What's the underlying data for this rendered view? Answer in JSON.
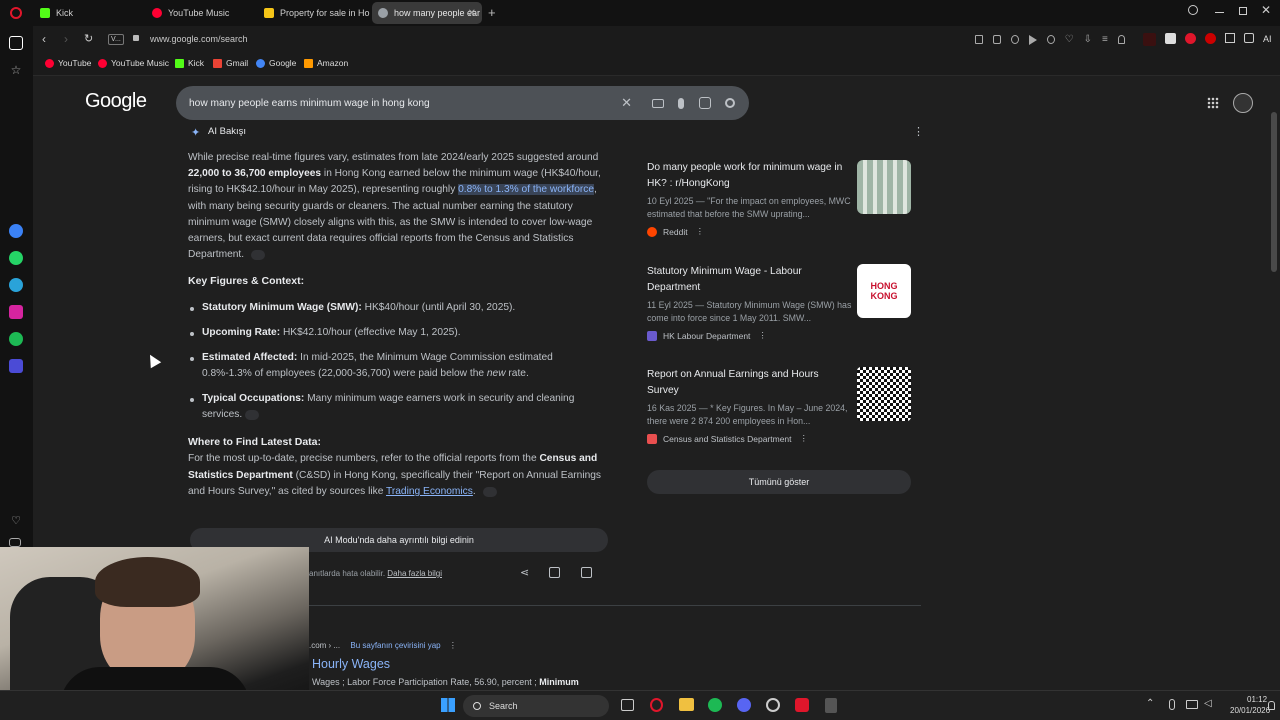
{
  "tabs": [
    {
      "label": "Kick",
      "color": "#53fc18"
    },
    {
      "label": "YouTube Music",
      "color": "#ff0033"
    },
    {
      "label": "Property for sale in Hong",
      "color": "#f5c518"
    },
    {
      "label": "how many people earns m",
      "color": "#9aa0a6"
    }
  ],
  "address": {
    "url": "www.google.com/search",
    "site_badge": "V..."
  },
  "bookmarks": [
    {
      "label": "YouTube",
      "color": "#ff0033"
    },
    {
      "label": "YouTube Music",
      "color": "#ff0033"
    },
    {
      "label": "Kick",
      "color": "#53fc18"
    },
    {
      "label": "Gmail",
      "color": "#ea4335"
    },
    {
      "label": "Google",
      "color": "#4285f4"
    },
    {
      "label": "Amazon",
      "color": "#ff9900"
    }
  ],
  "google": {
    "logo": "Google",
    "query": "how many people earns minimum wage in hong kong"
  },
  "ai": {
    "header": "AI Bakışı",
    "para_pre": "While precise real-time figures vary, estimates from late 2024/early 2025 suggested around ",
    "para_bold": "22,000 to 36,700 employees",
    "para_mid": " in Hong Kong earned below the minimum wage (HK$40/hour, rising to HK$42.10/hour in May 2025), representing roughly ",
    "para_hl": "0.8% to 1.3% of the workforce",
    "para_post": ", with many being security guards or cleaners. The actual number earning the statutory minimum wage (SMW) closely aligns with this, as the SMW is intended to cover low-wage earners, but exact current data requires official reports from the Census and Statistics Department.",
    "key_heading": "Key Figures & Context:",
    "bullets": [
      {
        "bold": "Statutory Minimum Wage (SMW):",
        "text": " HK$40/hour (until April 30, 2025)."
      },
      {
        "bold": "Upcoming Rate:",
        "text": " HK$42.10/hour (effective May 1, 2025)."
      },
      {
        "bold": "Estimated Affected:",
        "text": " In mid-2025, the Minimum Wage Commission estimated 0.8%-1.3% of employees (22,000-36,700) were paid below the ",
        "italic": "new",
        "text2": " rate."
      },
      {
        "bold": "Typical Occupations:",
        "text": " Many minimum wage earners work in security and cleaning services."
      }
    ],
    "where_heading": "Where to Find Latest Data:",
    "where_pre": "For the most up-to-date, precise numbers, refer to the official reports from the ",
    "where_bold": "Census and Statistics Department",
    "where_mid": " (C&SD) in Hong Kong, specifically their \"Report on Annual Earnings and Hours Survey,\" as cited by sources like ",
    "where_link": "Trading Economics",
    "where_post": ".",
    "ai_mode_button": "AI Modu'nda daha ayrıntılı bilgi edinin",
    "disclaimer": "anıtlarda hata olabilir.",
    "disclaimer_link": "Daha fazla bilgi"
  },
  "cards": [
    {
      "title": "Do many people work for minimum wage in HK? : r/HongKong",
      "snippet": "10 Eyl 2025 — \"For the impact on employees, MWC estimated that before the SMW uprating...",
      "source": "Reddit",
      "src_color": "#ff4500"
    },
    {
      "title": "Statutory Minimum Wage - Labour Department",
      "snippet": "11 Eyl 2025 — Statutory Minimum Wage (SMW) has come into force since 1 May 2011. SMW...",
      "source": "HK Labour Department",
      "src_color": "#6a5acd",
      "thumb_text": "HONG KONG"
    },
    {
      "title": "Report on Annual Earnings and Hours Survey",
      "snippet": "16 Kas 2025 — * Key Figures. In May – June 2024, there were 2 874 200 employees in Hon...",
      "source": "Census and Statistics Department",
      "src_color": "#e94f4f"
    }
  ],
  "show_all": "Tümünü göster",
  "result": {
    "crumb": ".com › ...",
    "translate": "Bu sayfanın çevirisini yap",
    "title": "Hourly Wages",
    "snippet_pre": "Wages ; Labor Force Participation Rate, 56.90, percent ; ",
    "snippet_bold": "Minimum"
  },
  "taskbar": {
    "search": "Search",
    "time": "01:12",
    "date": "20/01/2026"
  }
}
